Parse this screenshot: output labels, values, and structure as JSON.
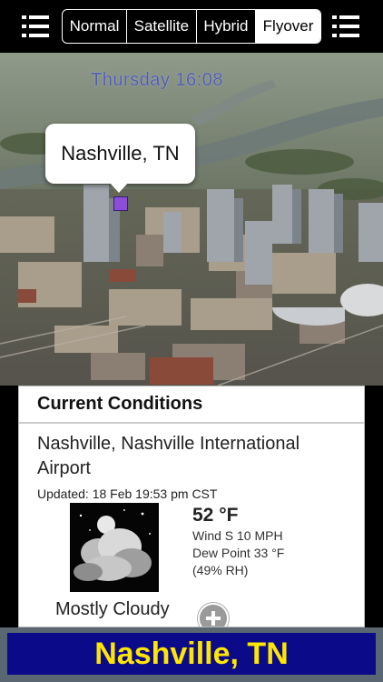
{
  "segments": [
    {
      "label": "Normal",
      "active": false
    },
    {
      "label": "Satellite",
      "active": false
    },
    {
      "label": "Hybrid",
      "active": false
    },
    {
      "label": "Flyover",
      "active": true
    }
  ],
  "icons": {
    "left_menu": "list-icon",
    "right_menu": "list-icon",
    "pin": "pin-icon",
    "add": "plus-circle-icon",
    "weather": "cloudy-night-icon"
  },
  "map": {
    "datetime": "Thursday 16:08",
    "callout": "Nashville, TN"
  },
  "conditions": {
    "header": "Current Conditions",
    "station": "Nashville, Nashville International Airport",
    "updated": "Updated: 18 Feb 19:53 pm CST",
    "temperature": "52 °F",
    "wind": "Wind S 10 MPH",
    "dew_point": "Dew Point 33 °F",
    "humidity": "(49% RH)",
    "summary": "Mostly Cloudy"
  },
  "banner": {
    "city": "Nashville, TN"
  },
  "colors": {
    "banner_bg": "#0b0b8a",
    "banner_text": "#ffe600",
    "pin": "#8a4fd6"
  }
}
